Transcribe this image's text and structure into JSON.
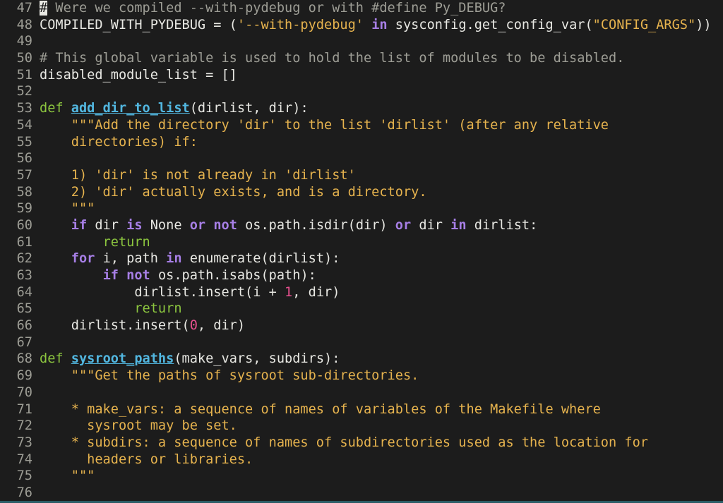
{
  "editor": {
    "theme_colors": {
      "background": "#1c1c1c",
      "default": "#e8e8e3",
      "line_number": "#9d9d95",
      "comment": "#9d9d95",
      "keyword": "#a77fe6",
      "def_keyword": "#8cc63f",
      "function_name": "#52b7e0",
      "string": "#e6b34e",
      "number": "#e8508f",
      "return": "#8cc63f"
    },
    "cursor": {
      "line": 47,
      "column": 1,
      "char": "#"
    },
    "lines": [
      {
        "num": "47",
        "tokens": [
          {
            "t": "cursor",
            "v": "#"
          },
          {
            "t": "comment",
            "v": " Were we compiled --with-pydebug or with #define Py_DEBUG?"
          }
        ]
      },
      {
        "num": "48",
        "tokens": [
          {
            "t": "plain",
            "v": "COMPILED_WITH_PYDEBUG = ("
          },
          {
            "t": "string",
            "v": "'--with-pydebug'"
          },
          {
            "t": "plain",
            "v": " "
          },
          {
            "t": "keyword",
            "v": "in"
          },
          {
            "t": "plain",
            "v": " sysconfig.get_config_var("
          },
          {
            "t": "string",
            "v": "\"CONFIG_ARGS\""
          },
          {
            "t": "plain",
            "v": "))"
          }
        ]
      },
      {
        "num": "49",
        "tokens": []
      },
      {
        "num": "50",
        "tokens": [
          {
            "t": "comment",
            "v": "# This global variable is used to hold the list of modules to be disabled."
          }
        ]
      },
      {
        "num": "51",
        "tokens": [
          {
            "t": "plain",
            "v": "disabled_module_list = []"
          }
        ]
      },
      {
        "num": "52",
        "tokens": []
      },
      {
        "num": "53",
        "tokens": [
          {
            "t": "def",
            "v": "def"
          },
          {
            "t": "plain",
            "v": " "
          },
          {
            "t": "func",
            "v": "add_dir_to_list"
          },
          {
            "t": "plain",
            "v": "(dirlist, dir):"
          }
        ]
      },
      {
        "num": "54",
        "tokens": [
          {
            "t": "plain",
            "v": "    "
          },
          {
            "t": "string",
            "v": "\"\"\"Add the directory 'dir' to the list 'dirlist' (after any relative"
          }
        ]
      },
      {
        "num": "55",
        "tokens": [
          {
            "t": "string",
            "v": "    directories) if:"
          }
        ]
      },
      {
        "num": "56",
        "tokens": []
      },
      {
        "num": "57",
        "tokens": [
          {
            "t": "string",
            "v": "    1) 'dir' is not already in 'dirlist'"
          }
        ]
      },
      {
        "num": "58",
        "tokens": [
          {
            "t": "string",
            "v": "    2) 'dir' actually exists, and is a directory."
          }
        ]
      },
      {
        "num": "59",
        "tokens": [
          {
            "t": "string",
            "v": "    \"\"\""
          }
        ]
      },
      {
        "num": "60",
        "tokens": [
          {
            "t": "plain",
            "v": "    "
          },
          {
            "t": "keyword",
            "v": "if"
          },
          {
            "t": "plain",
            "v": " dir "
          },
          {
            "t": "keyword",
            "v": "is"
          },
          {
            "t": "plain",
            "v": " None "
          },
          {
            "t": "keyword",
            "v": "or"
          },
          {
            "t": "plain",
            "v": " "
          },
          {
            "t": "keyword",
            "v": "not"
          },
          {
            "t": "plain",
            "v": " os.path.isdir(dir) "
          },
          {
            "t": "keyword",
            "v": "or"
          },
          {
            "t": "plain",
            "v": " dir "
          },
          {
            "t": "keyword",
            "v": "in"
          },
          {
            "t": "plain",
            "v": " dirlist:"
          }
        ]
      },
      {
        "num": "61",
        "tokens": [
          {
            "t": "plain",
            "v": "        "
          },
          {
            "t": "return",
            "v": "return"
          }
        ]
      },
      {
        "num": "62",
        "tokens": [
          {
            "t": "plain",
            "v": "    "
          },
          {
            "t": "keyword",
            "v": "for"
          },
          {
            "t": "plain",
            "v": " i, path "
          },
          {
            "t": "keyword",
            "v": "in"
          },
          {
            "t": "plain",
            "v": " enumerate(dirlist):"
          }
        ]
      },
      {
        "num": "63",
        "tokens": [
          {
            "t": "plain",
            "v": "        "
          },
          {
            "t": "keyword",
            "v": "if"
          },
          {
            "t": "plain",
            "v": " "
          },
          {
            "t": "keyword",
            "v": "not"
          },
          {
            "t": "plain",
            "v": " os.path.isabs(path):"
          }
        ]
      },
      {
        "num": "64",
        "tokens": [
          {
            "t": "plain",
            "v": "            dirlist.insert(i + "
          },
          {
            "t": "number",
            "v": "1"
          },
          {
            "t": "plain",
            "v": ", dir)"
          }
        ]
      },
      {
        "num": "65",
        "tokens": [
          {
            "t": "plain",
            "v": "            "
          },
          {
            "t": "return",
            "v": "return"
          }
        ]
      },
      {
        "num": "66",
        "tokens": [
          {
            "t": "plain",
            "v": "    dirlist.insert("
          },
          {
            "t": "number",
            "v": "0"
          },
          {
            "t": "plain",
            "v": ", dir)"
          }
        ]
      },
      {
        "num": "67",
        "tokens": []
      },
      {
        "num": "68",
        "tokens": [
          {
            "t": "def",
            "v": "def"
          },
          {
            "t": "plain",
            "v": " "
          },
          {
            "t": "func",
            "v": "sysroot_paths"
          },
          {
            "t": "plain",
            "v": "(make_vars, subdirs):"
          }
        ]
      },
      {
        "num": "69",
        "tokens": [
          {
            "t": "plain",
            "v": "    "
          },
          {
            "t": "string",
            "v": "\"\"\"Get the paths of sysroot sub-directories."
          }
        ]
      },
      {
        "num": "70",
        "tokens": []
      },
      {
        "num": "71",
        "tokens": [
          {
            "t": "string",
            "v": "    * make_vars: a sequence of names of variables of the Makefile where"
          }
        ]
      },
      {
        "num": "72",
        "tokens": [
          {
            "t": "string",
            "v": "      sysroot may be set."
          }
        ]
      },
      {
        "num": "73",
        "tokens": [
          {
            "t": "string",
            "v": "    * subdirs: a sequence of names of subdirectories used as the location for"
          }
        ]
      },
      {
        "num": "74",
        "tokens": [
          {
            "t": "string",
            "v": "      headers or libraries."
          }
        ]
      },
      {
        "num": "75",
        "tokens": [
          {
            "t": "string",
            "v": "    \"\"\""
          }
        ]
      },
      {
        "num": "76",
        "tokens": []
      }
    ]
  }
}
